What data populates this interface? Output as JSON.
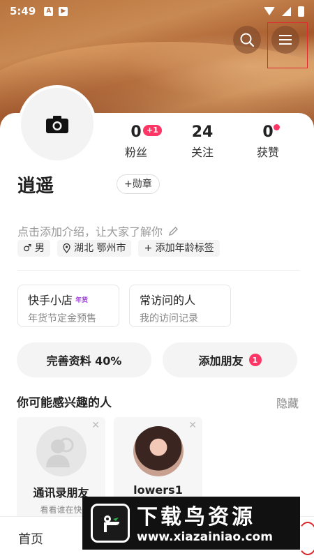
{
  "status_bar": {
    "time": "5:49",
    "icon_a": "A",
    "icon_b": "▶"
  },
  "header": {
    "search_icon": "search-icon",
    "menu_icon": "menu-icon"
  },
  "profile": {
    "avatar_icon": "camera-icon",
    "name": "逍遥",
    "medal_label": "+勋章",
    "intro_placeholder": "点击添加介绍，让大家了解你",
    "tags": {
      "gender": "♂ 男",
      "location": "湖北 鄂州市",
      "age": "+ 添加年龄标签"
    }
  },
  "stats": {
    "fans": {
      "value": "0",
      "label": "粉丝",
      "badge": "+1"
    },
    "follow": {
      "value": "24",
      "label": "关注"
    },
    "likes": {
      "value": "0",
      "label": "获赞"
    }
  },
  "boxes": {
    "shop": {
      "title": "快手小店",
      "tag": "年货",
      "sub": "年货节定金预售"
    },
    "visitors": {
      "title": "常访问的人",
      "sub": "我的访问记录"
    }
  },
  "actions": {
    "complete_profile": "完善资料 40%",
    "add_friends": "添加朋友",
    "add_friends_badge": "1"
  },
  "suggestions": {
    "title": "你可能感兴趣的人",
    "hide_label": "隐藏",
    "items": [
      {
        "name": "通讯录朋友",
        "sub": "看看谁在快"
      },
      {
        "name": "lowers1",
        "sub": ""
      }
    ]
  },
  "tabbar": {
    "home": "首页"
  },
  "watermark": {
    "title": "下载鸟资源",
    "url": "www.xiazainiao.com"
  },
  "colors": {
    "accent": "#fe3666",
    "highlight_box": "#e0282e"
  }
}
